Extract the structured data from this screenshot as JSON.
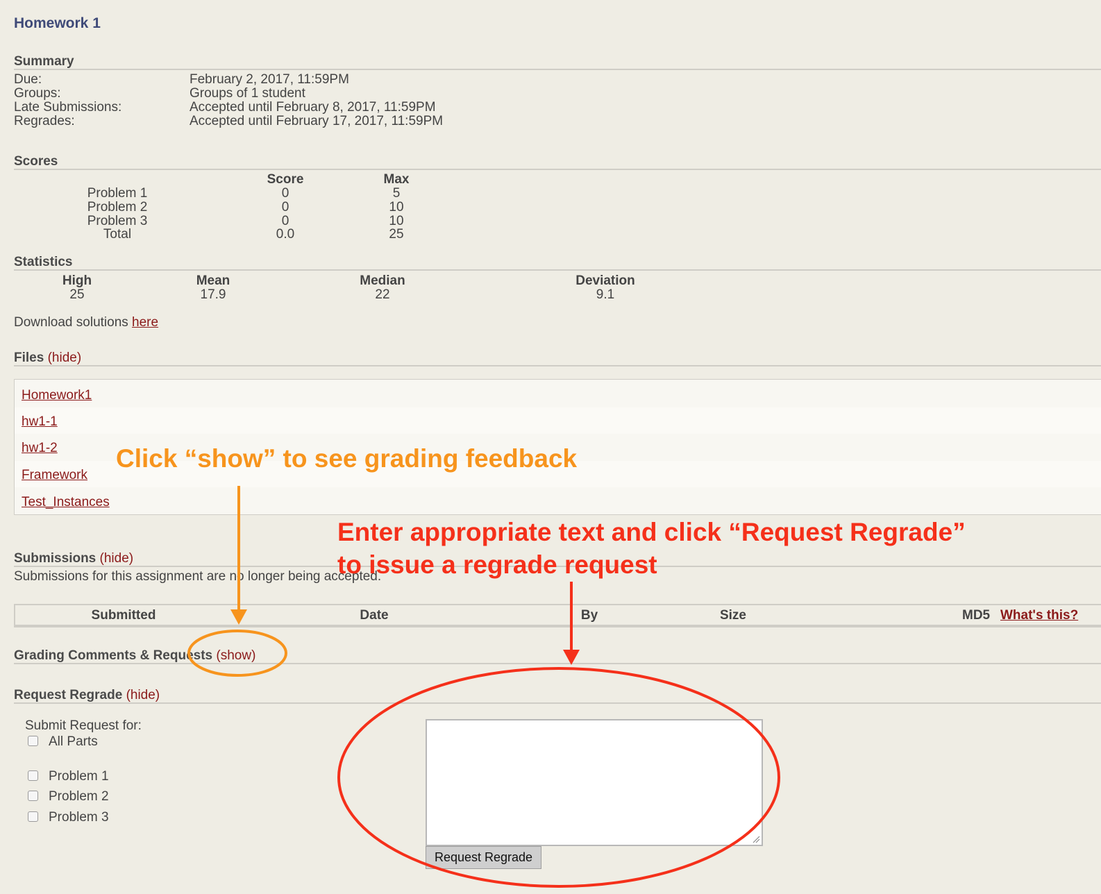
{
  "title": "Homework 1",
  "summary": {
    "heading": "Summary",
    "rows": [
      {
        "label": "Due:",
        "value": "February 2, 2017, 11:59PM"
      },
      {
        "label": "Groups:",
        "value": "Groups of 1 student"
      },
      {
        "label": "Late Submissions:",
        "value": "Accepted until February 8, 2017, 11:59PM"
      },
      {
        "label": "Regrades:",
        "value": "Accepted until February 17, 2017, 11:59PM"
      }
    ]
  },
  "scores": {
    "heading": "Scores",
    "col_score": "Score",
    "col_max": "Max",
    "rows": [
      {
        "name": "Problem 1",
        "score": "0",
        "max": "5"
      },
      {
        "name": "Problem 2",
        "score": "0",
        "max": "10"
      },
      {
        "name": "Problem 3",
        "score": "0",
        "max": "10"
      },
      {
        "name": "Total",
        "score": "0.0",
        "max": "25"
      }
    ]
  },
  "statistics": {
    "heading": "Statistics",
    "cols": [
      {
        "label": "High",
        "value": "25"
      },
      {
        "label": "Mean",
        "value": "17.9"
      },
      {
        "label": "Median",
        "value": "22"
      },
      {
        "label": "Deviation",
        "value": "9.1"
      }
    ]
  },
  "download": {
    "text": "Download solutions",
    "link": "here"
  },
  "files": {
    "heading": "Files",
    "toggle": "(hide)",
    "items": [
      "Homework1",
      "hw1-1",
      "hw1-2",
      "Framework",
      "Test_Instances"
    ]
  },
  "submissions": {
    "heading": "Submissions",
    "toggle": "(hide)",
    "notice": "Submissions for this assignment are no longer being accepted.",
    "columns": {
      "submitted": "Submitted",
      "date": "Date",
      "by": "By",
      "size": "Size",
      "md5": "MD5",
      "whats_this": "What's this?"
    }
  },
  "grading": {
    "heading": "Grading Comments & Requests",
    "toggle": "(show)"
  },
  "regrade": {
    "heading": "Request Regrade",
    "toggle": "(hide)",
    "submit_for": "Submit Request for:",
    "options": [
      "All Parts",
      "Problem 1",
      "Problem 2",
      "Problem 3"
    ],
    "button": "Request Regrade"
  },
  "annotations": {
    "show_hint": "Click “show” to see grading feedback",
    "regrade_hint_line1": "Enter appropriate text and click “Request Regrade”",
    "regrade_hint_line2": "to issue a regrade request",
    "orange": "#f7941d",
    "red": "#f5301a"
  }
}
